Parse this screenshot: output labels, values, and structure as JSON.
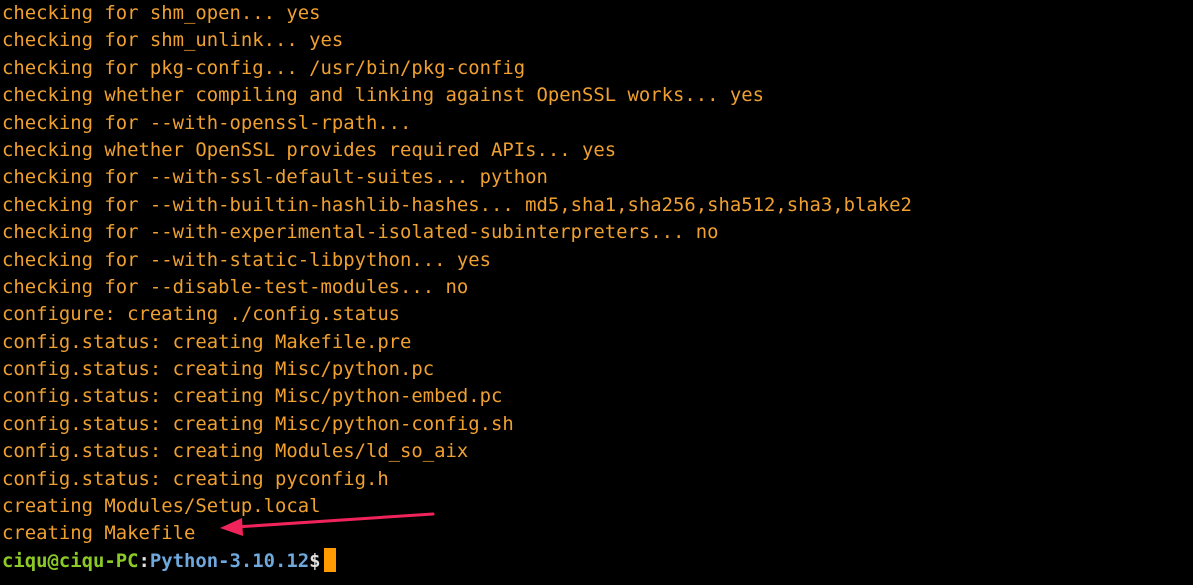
{
  "output_lines": [
    "checking for shm_open... yes",
    "checking for shm_unlink... yes",
    "checking for pkg-config... /usr/bin/pkg-config",
    "checking whether compiling and linking against OpenSSL works... yes",
    "checking for --with-openssl-rpath...",
    "checking whether OpenSSL provides required APIs... yes",
    "checking for --with-ssl-default-suites... python",
    "checking for --with-builtin-hashlib-hashes... md5,sha1,sha256,sha512,sha3,blake2",
    "checking for --with-experimental-isolated-subinterpreters... no",
    "checking for --with-static-libpython... yes",
    "checking for --disable-test-modules... no",
    "configure: creating ./config.status",
    "config.status: creating Makefile.pre",
    "config.status: creating Misc/python.pc",
    "config.status: creating Misc/python-embed.pc",
    "config.status: creating Misc/python-config.sh",
    "config.status: creating Modules/ld_so_aix",
    "config.status: creating pyconfig.h",
    "creating Modules/Setup.local",
    "creating Makefile"
  ],
  "prompt": {
    "user_host": "ciqu@ciqu-PC",
    "separator": ":",
    "path": "Python-3.10.12",
    "symbol": "$"
  },
  "colors": {
    "background": "#000000",
    "output_text": "#f0a030",
    "prompt_user": "#8ac926",
    "prompt_path": "#6fa8dc",
    "cursor": "#ff9a00",
    "annotation_arrow": "#f0245a"
  },
  "annotation": {
    "icon": "arrow-icon",
    "points_to": "creating Makefile"
  }
}
